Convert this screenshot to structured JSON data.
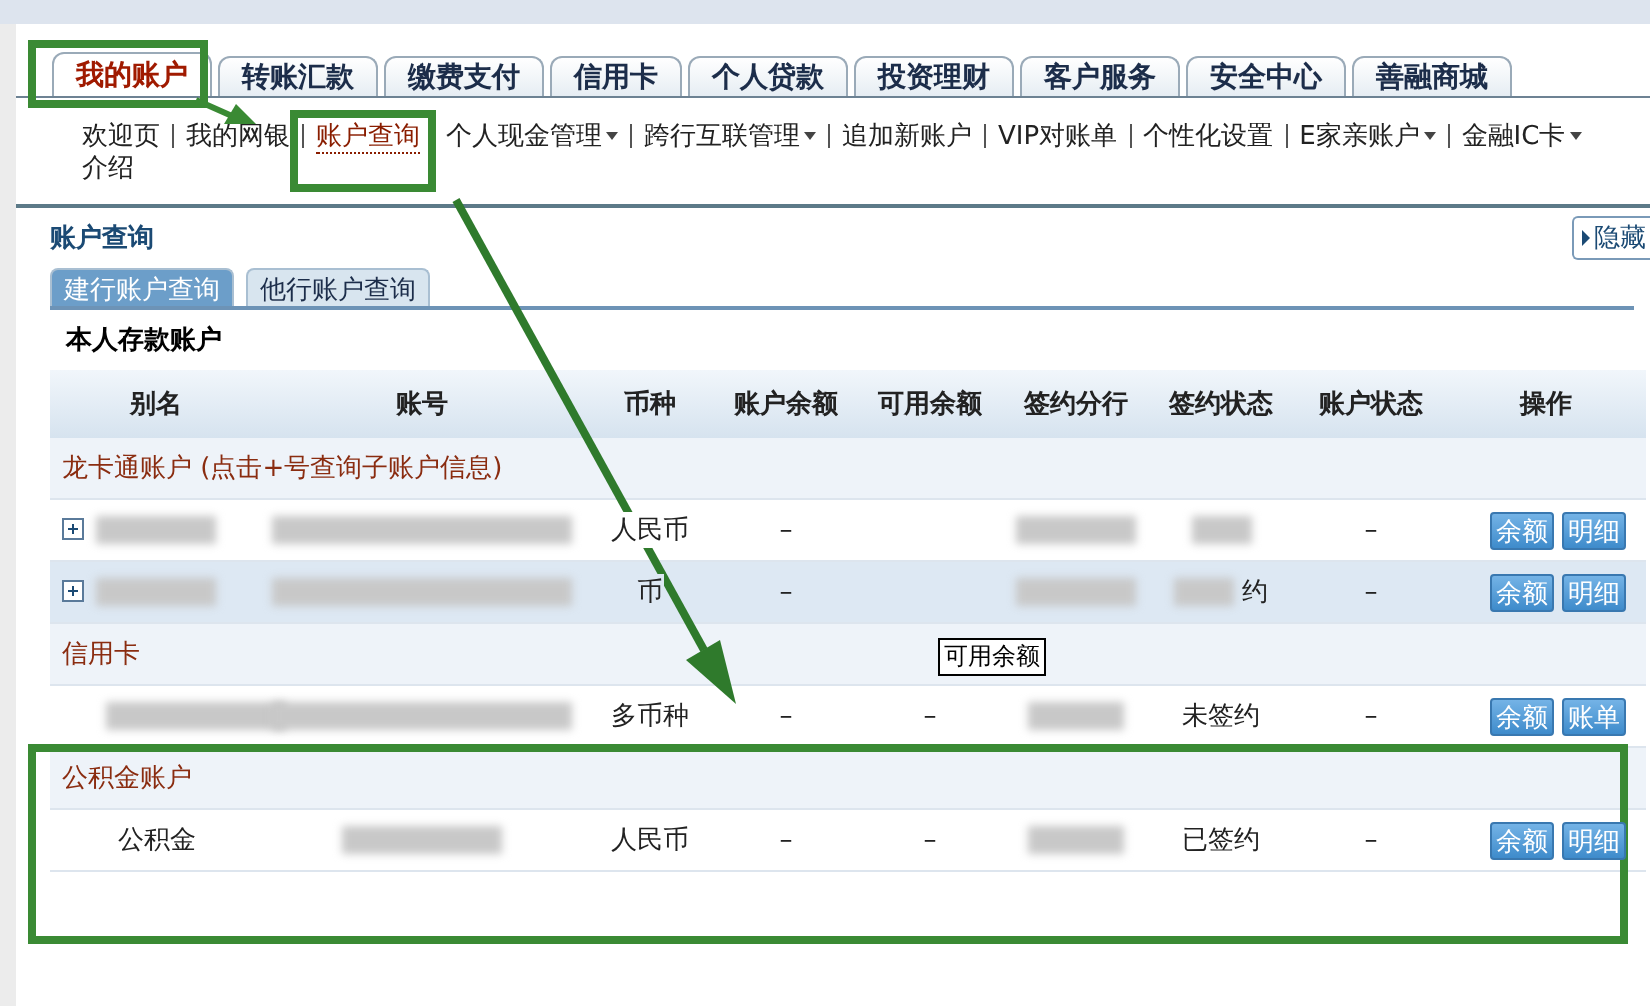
{
  "top_tabs": [
    {
      "label": "我的账户",
      "selected": true
    },
    {
      "label": "转账汇款",
      "selected": false
    },
    {
      "label": "缴费支付",
      "selected": false
    },
    {
      "label": "信用卡",
      "selected": false
    },
    {
      "label": "个人贷款",
      "selected": false
    },
    {
      "label": "投资理财",
      "selected": false
    },
    {
      "label": "客户服务",
      "selected": false
    },
    {
      "label": "安全中心",
      "selected": false
    },
    {
      "label": "善融商城",
      "selected": false
    }
  ],
  "sub_nav": [
    {
      "label": "欢迎页",
      "selected": false,
      "dropdown": false
    },
    {
      "label": "我的网银",
      "selected": false,
      "dropdown": false
    },
    {
      "label": "账户查询",
      "selected": true,
      "dropdown": false
    },
    {
      "label": "个人现金管理",
      "selected": false,
      "dropdown": true
    },
    {
      "label": "跨行互联管理",
      "selected": false,
      "dropdown": true
    },
    {
      "label": "追加新账户",
      "selected": false,
      "dropdown": false
    },
    {
      "label": "VIP对账单",
      "selected": false,
      "dropdown": false
    },
    {
      "label": "个性化设置",
      "selected": false,
      "dropdown": false
    },
    {
      "label": "E家亲账户",
      "selected": false,
      "dropdown": true
    },
    {
      "label": "金融IC卡",
      "selected": false,
      "dropdown": true
    },
    {
      "label": "介绍",
      "selected": false,
      "dropdown": false
    }
  ],
  "panel": {
    "title": "账户查询",
    "hide_button": "隐藏",
    "tabs": [
      {
        "label": "建行账户查询",
        "selected": true
      },
      {
        "label": "他行账户查询",
        "selected": false
      }
    ],
    "group_title": "本人存款账户",
    "columns": [
      "别名",
      "账号",
      "币种",
      "账户余额",
      "可用余额",
      "签约分行",
      "签约状态",
      "账户状态",
      "操作"
    ],
    "sections": [
      {
        "title": "龙卡通账户 (点击+号查询子账户信息)",
        "rows": [
          {
            "expandable": true,
            "shaded": false,
            "alias_masked": true,
            "account_masked": true,
            "currency": "人民币",
            "balance": "–",
            "branch_masked": true,
            "status_masked": true,
            "acct_status": "–",
            "actions": [
              "余额",
              "明细"
            ]
          },
          {
            "expandable": true,
            "shaded": true,
            "alias_masked": true,
            "account_masked": true,
            "currency": "币",
            "balance": "–",
            "branch_masked": true,
            "status": "约",
            "status_masked": true,
            "acct_status": "–",
            "actions": [
              "余额",
              "明细"
            ]
          }
        ]
      },
      {
        "title": "信用卡",
        "rows": [
          {
            "expandable": false,
            "shaded": false,
            "alias_masked": true,
            "account_masked": true,
            "currency": "多币种",
            "balance": "–",
            "available": "–",
            "branch_masked": true,
            "status": "未签约",
            "status_masked": false,
            "acct_status": "–",
            "actions": [
              "余额",
              "账单"
            ]
          }
        ]
      },
      {
        "title": "公积金账户",
        "rows": [
          {
            "expandable": false,
            "shaded": false,
            "alias": "公积金",
            "alias_masked": false,
            "account_masked": true,
            "currency": "人民币",
            "balance": "–",
            "available": "–",
            "branch_masked": true,
            "status": "已签约",
            "status_masked": false,
            "acct_status": "–",
            "actions": [
              "余额",
              "明细"
            ]
          }
        ]
      }
    ],
    "tooltip": "可用余额"
  }
}
